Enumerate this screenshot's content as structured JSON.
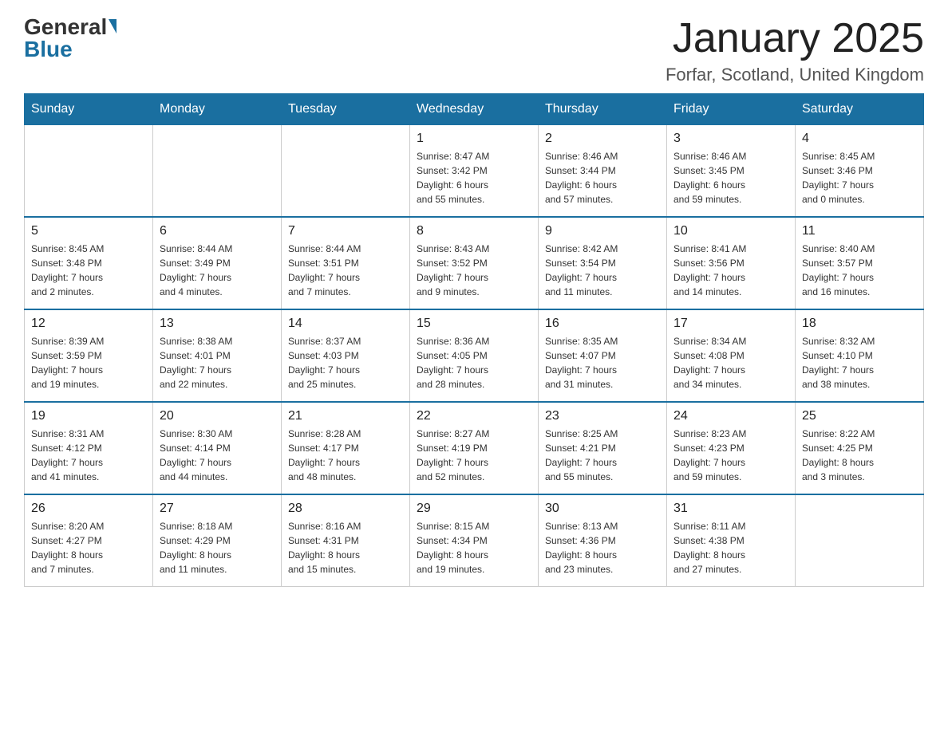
{
  "header": {
    "logo_general": "General",
    "logo_blue": "Blue",
    "title": "January 2025",
    "location": "Forfar, Scotland, United Kingdom"
  },
  "calendar": {
    "days_of_week": [
      "Sunday",
      "Monday",
      "Tuesday",
      "Wednesday",
      "Thursday",
      "Friday",
      "Saturday"
    ],
    "weeks": [
      [
        {
          "day": "",
          "info": ""
        },
        {
          "day": "",
          "info": ""
        },
        {
          "day": "",
          "info": ""
        },
        {
          "day": "1",
          "info": "Sunrise: 8:47 AM\nSunset: 3:42 PM\nDaylight: 6 hours\nand 55 minutes."
        },
        {
          "day": "2",
          "info": "Sunrise: 8:46 AM\nSunset: 3:44 PM\nDaylight: 6 hours\nand 57 minutes."
        },
        {
          "day": "3",
          "info": "Sunrise: 8:46 AM\nSunset: 3:45 PM\nDaylight: 6 hours\nand 59 minutes."
        },
        {
          "day": "4",
          "info": "Sunrise: 8:45 AM\nSunset: 3:46 PM\nDaylight: 7 hours\nand 0 minutes."
        }
      ],
      [
        {
          "day": "5",
          "info": "Sunrise: 8:45 AM\nSunset: 3:48 PM\nDaylight: 7 hours\nand 2 minutes."
        },
        {
          "day": "6",
          "info": "Sunrise: 8:44 AM\nSunset: 3:49 PM\nDaylight: 7 hours\nand 4 minutes."
        },
        {
          "day": "7",
          "info": "Sunrise: 8:44 AM\nSunset: 3:51 PM\nDaylight: 7 hours\nand 7 minutes."
        },
        {
          "day": "8",
          "info": "Sunrise: 8:43 AM\nSunset: 3:52 PM\nDaylight: 7 hours\nand 9 minutes."
        },
        {
          "day": "9",
          "info": "Sunrise: 8:42 AM\nSunset: 3:54 PM\nDaylight: 7 hours\nand 11 minutes."
        },
        {
          "day": "10",
          "info": "Sunrise: 8:41 AM\nSunset: 3:56 PM\nDaylight: 7 hours\nand 14 minutes."
        },
        {
          "day": "11",
          "info": "Sunrise: 8:40 AM\nSunset: 3:57 PM\nDaylight: 7 hours\nand 16 minutes."
        }
      ],
      [
        {
          "day": "12",
          "info": "Sunrise: 8:39 AM\nSunset: 3:59 PM\nDaylight: 7 hours\nand 19 minutes."
        },
        {
          "day": "13",
          "info": "Sunrise: 8:38 AM\nSunset: 4:01 PM\nDaylight: 7 hours\nand 22 minutes."
        },
        {
          "day": "14",
          "info": "Sunrise: 8:37 AM\nSunset: 4:03 PM\nDaylight: 7 hours\nand 25 minutes."
        },
        {
          "day": "15",
          "info": "Sunrise: 8:36 AM\nSunset: 4:05 PM\nDaylight: 7 hours\nand 28 minutes."
        },
        {
          "day": "16",
          "info": "Sunrise: 8:35 AM\nSunset: 4:07 PM\nDaylight: 7 hours\nand 31 minutes."
        },
        {
          "day": "17",
          "info": "Sunrise: 8:34 AM\nSunset: 4:08 PM\nDaylight: 7 hours\nand 34 minutes."
        },
        {
          "day": "18",
          "info": "Sunrise: 8:32 AM\nSunset: 4:10 PM\nDaylight: 7 hours\nand 38 minutes."
        }
      ],
      [
        {
          "day": "19",
          "info": "Sunrise: 8:31 AM\nSunset: 4:12 PM\nDaylight: 7 hours\nand 41 minutes."
        },
        {
          "day": "20",
          "info": "Sunrise: 8:30 AM\nSunset: 4:14 PM\nDaylight: 7 hours\nand 44 minutes."
        },
        {
          "day": "21",
          "info": "Sunrise: 8:28 AM\nSunset: 4:17 PM\nDaylight: 7 hours\nand 48 minutes."
        },
        {
          "day": "22",
          "info": "Sunrise: 8:27 AM\nSunset: 4:19 PM\nDaylight: 7 hours\nand 52 minutes."
        },
        {
          "day": "23",
          "info": "Sunrise: 8:25 AM\nSunset: 4:21 PM\nDaylight: 7 hours\nand 55 minutes."
        },
        {
          "day": "24",
          "info": "Sunrise: 8:23 AM\nSunset: 4:23 PM\nDaylight: 7 hours\nand 59 minutes."
        },
        {
          "day": "25",
          "info": "Sunrise: 8:22 AM\nSunset: 4:25 PM\nDaylight: 8 hours\nand 3 minutes."
        }
      ],
      [
        {
          "day": "26",
          "info": "Sunrise: 8:20 AM\nSunset: 4:27 PM\nDaylight: 8 hours\nand 7 minutes."
        },
        {
          "day": "27",
          "info": "Sunrise: 8:18 AM\nSunset: 4:29 PM\nDaylight: 8 hours\nand 11 minutes."
        },
        {
          "day": "28",
          "info": "Sunrise: 8:16 AM\nSunset: 4:31 PM\nDaylight: 8 hours\nand 15 minutes."
        },
        {
          "day": "29",
          "info": "Sunrise: 8:15 AM\nSunset: 4:34 PM\nDaylight: 8 hours\nand 19 minutes."
        },
        {
          "day": "30",
          "info": "Sunrise: 8:13 AM\nSunset: 4:36 PM\nDaylight: 8 hours\nand 23 minutes."
        },
        {
          "day": "31",
          "info": "Sunrise: 8:11 AM\nSunset: 4:38 PM\nDaylight: 8 hours\nand 27 minutes."
        },
        {
          "day": "",
          "info": ""
        }
      ]
    ]
  }
}
